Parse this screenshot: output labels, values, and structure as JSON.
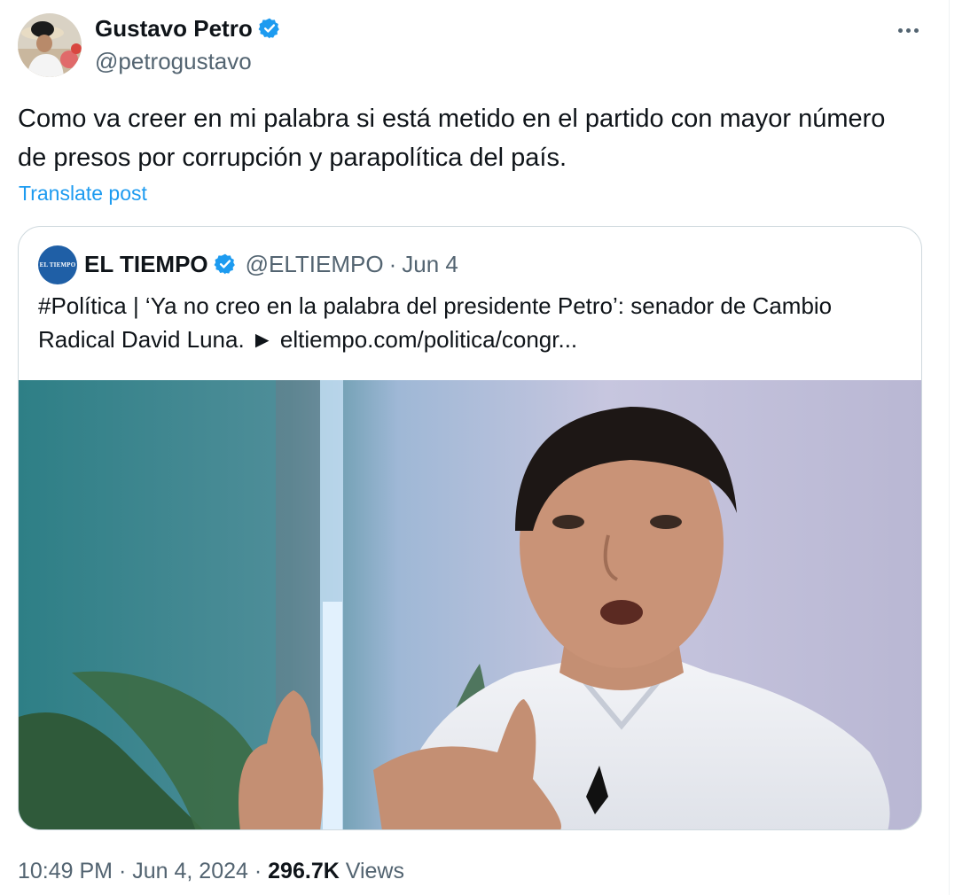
{
  "post": {
    "author": {
      "name": "Gustavo Petro",
      "handle": "@petrogustavo",
      "verified": true
    },
    "text": "Como va creer en mi palabra si está metido en el partido con mayor número de presos por corrupción y parapolítica del país.",
    "translate_label": "Translate post",
    "time": "10:49 PM",
    "date": "Jun 4, 2024",
    "views_count": "296.7K",
    "views_label": "Views",
    "separator": "·"
  },
  "quote": {
    "avatar_text": "EL TIEMPO",
    "name": "EL TIEMPO",
    "handle": "@ELTIEMPO",
    "date": "Jun 4",
    "separator": "·",
    "verified": true,
    "text": "#Política | ‘Ya no creo en la palabra del presidente Petro’: senador de Cambio Radical David Luna. ► eltiempo.com/politica/congr..."
  },
  "icons": {
    "verified": "verified-badge-icon",
    "more": "more-horizontal-icon"
  },
  "colors": {
    "text_primary": "#0f1419",
    "text_secondary": "#536471",
    "link": "#1d9bf0",
    "verified": "#1d9bf0",
    "border": "#cfd9de"
  }
}
